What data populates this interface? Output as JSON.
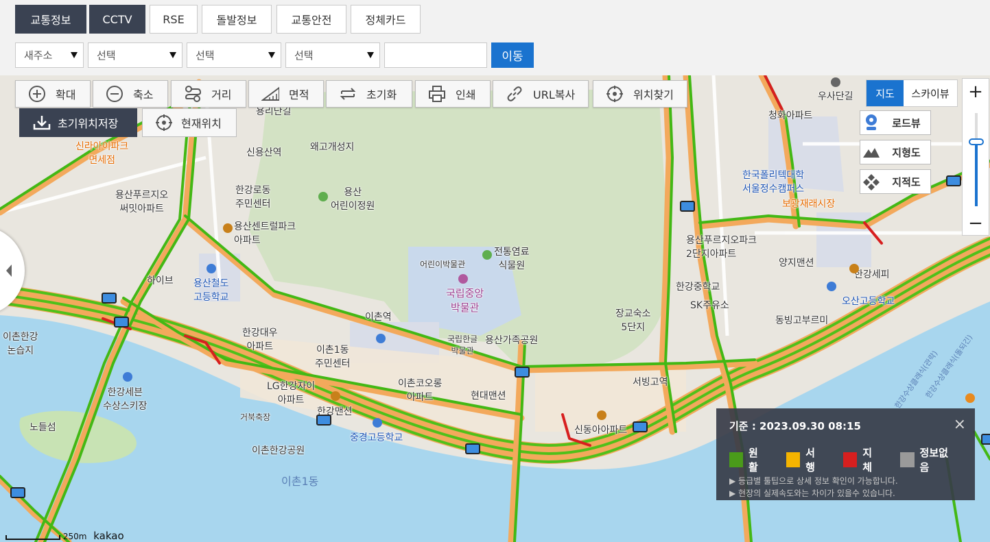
{
  "tabs": [
    {
      "label": "교통정보",
      "active": true
    },
    {
      "label": "CCTV",
      "active": true
    },
    {
      "label": "RSE",
      "active": false
    },
    {
      "label": "돌발정보",
      "active": false
    },
    {
      "label": "교통안전",
      "active": false
    },
    {
      "label": "정체카드",
      "active": false
    }
  ],
  "search": {
    "address_type": "새주소",
    "select1": "선택",
    "select2": "선택",
    "select3": "선택",
    "input_value": "",
    "go_label": "이동"
  },
  "toolbar": {
    "zoom_in": "확대",
    "zoom_out": "축소",
    "distance": "거리",
    "area": "면적",
    "reset": "초기화",
    "print": "인쇄",
    "url_copy": "URL복사",
    "locate": "위치찾기",
    "save_initial": "초기위치저장",
    "current_location": "현재위치"
  },
  "map_type": {
    "map": "지도",
    "skyview": "스카이뷰"
  },
  "side_buttons": {
    "roadview": "로드뷰",
    "terrain": "지형도",
    "cadastral": "지적도"
  },
  "zoom": {
    "plus": "+",
    "minus": "−"
  },
  "legend": {
    "title": "기준 : 2023.09.30 08:15",
    "close": "×",
    "items": [
      {
        "label": "원활",
        "color": "#4a9b1a"
      },
      {
        "label": "서행",
        "color": "#f5b400"
      },
      {
        "label": "지체",
        "color": "#d71f1f"
      },
      {
        "label": "정보없음",
        "color": "#9a9a9a"
      }
    ],
    "notes": [
      "▶ 등급별 툴팁으로 상세 정보 확인이 가능합니다.",
      "▶ 현장의 실제속도와는 차이가 있을수 있습니다."
    ]
  },
  "map_labels": {
    "yongsan_park": "용산\n어린이정원",
    "museum": "국립중앙\n박물관",
    "museum_kid": "어린이박물관",
    "hangangro_center": "한강로동\n주민센터",
    "sinyongsan": "신용산역",
    "waego": "왜고개성지",
    "yongridan": "용리단길",
    "central_park": "용산센트럴파크\n아파트",
    "railway_high": "용산철도\n고등학교",
    "hive": "하이브",
    "ichon1": "이촌1동\n주민센터",
    "ichon_station": "이촌역",
    "hangang_daewoo": "한강대우\n아파트",
    "lg_hangang": "LG한강자이\n아파트",
    "ichon_koorong": "이촌코오롱\n아파트",
    "hyundai_mansion": "현대맨션",
    "hangang_mansion": "한강맨션",
    "chungyeong_high": "중경고등학교",
    "ichon_park": "이촌한강공원",
    "ichon_dong": "이촌1동",
    "seobinggo": "서빙고역",
    "sindong": "신동아아파트",
    "yongsan_family": "용산가족공원",
    "hangul_museum": "국립한글\n박물관",
    "traditional_garden": "전통염료\n식물원",
    "janggyo": "장교숙소\n5단지",
    "polytech": "한국폴리텍대학\n서울정수캠퍼스",
    "boguang": "보광재래시장",
    "yangji": "양지맨션",
    "hangang_middle": "한강중학교",
    "oksan_high": "오산고등학교",
    "usan": "우사단길",
    "chunghwa": "청화아파트",
    "ichon_hangang_wetland": "이촌한강\n논습지",
    "hangang_sebit": "한강세븐\n수상스키장",
    "noddeul": "노들섬",
    "shilla": "신라아이파크\n면세점",
    "yongsan_prugio": "용산푸르지오\n써밋아파트",
    "yongsan_prugio2": "용산푸르지오파크\n2단지아파트",
    "donbing": "동빙고부르미",
    "ichonhangang": "한강세피",
    "geobuk": "거북축장",
    "sk": "SK주유소",
    "river_text1": "한강수상클래식(관락)",
    "river_text2": "한강수상클래식(돌되긴)",
    "kakao": "kakao",
    "scale": "250m"
  }
}
